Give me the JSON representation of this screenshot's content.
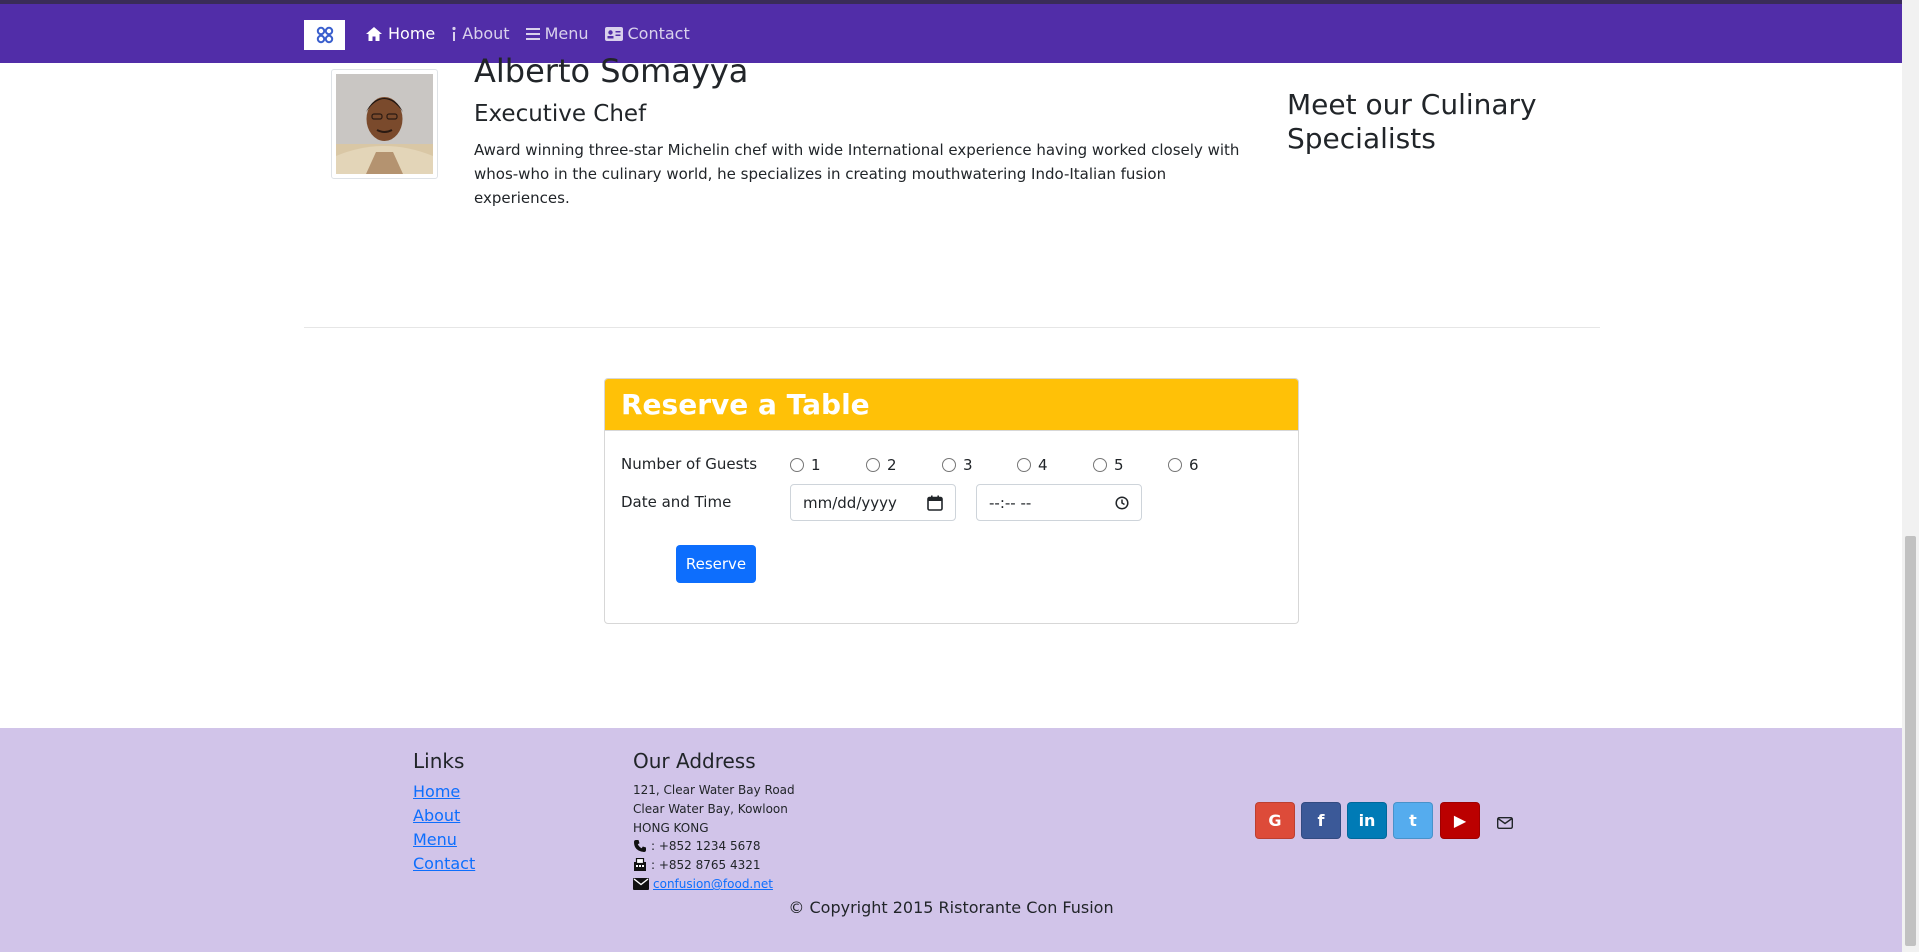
{
  "nav": {
    "items": [
      {
        "label": "Home",
        "icon": "home-icon"
      },
      {
        "label": "About",
        "icon": "info-icon"
      },
      {
        "label": "Menu",
        "icon": "list-icon"
      },
      {
        "label": "Contact",
        "icon": "address-card-icon"
      }
    ]
  },
  "leader": {
    "name": "Alberto Somayya",
    "title": "Executive Chef",
    "description": "Award winning three-star Michelin chef with wide International experience having worked closely with whos-who in the culinary world, he specializes in creating mouthwatering Indo-Italian fusion experiences."
  },
  "side_heading": "Meet our Culinary Specialists",
  "reservation": {
    "title": "Reserve a Table",
    "guests_label": "Number of Guests",
    "guest_options": [
      "1",
      "2",
      "3",
      "4",
      "5",
      "6"
    ],
    "datetime_label": "Date and Time",
    "date_placeholder": "mm/dd/yyyy",
    "time_placeholder": "--:-- --",
    "button_label": "Reserve"
  },
  "footer": {
    "links_heading": "Links",
    "links": [
      "Home",
      "About",
      "Menu",
      "Contact"
    ],
    "address_heading": "Our Address",
    "address_lines": [
      "121, Clear Water Bay Road",
      "Clear Water Bay, Kowloon",
      "HONG KONG"
    ],
    "phone": ": +852 1234 5678",
    "fax": ": +852 8765 4321",
    "email": "confusion@food.net",
    "social": [
      {
        "name": "google",
        "glyph": "G",
        "color": "#dd4b39"
      },
      {
        "name": "facebook",
        "glyph": "f",
        "color": "#3b5998"
      },
      {
        "name": "linkedin",
        "glyph": "in",
        "color": "#007bb6"
      },
      {
        "name": "twitter",
        "glyph": "t",
        "color": "#55acee"
      },
      {
        "name": "youtube",
        "glyph": "▶",
        "color": "#bb0000"
      }
    ],
    "copyright": "© Copyright 2015 Ristorante Con Fusion"
  },
  "colors": {
    "navbar": "#512da8",
    "card_header": "#ffc107",
    "footer_bg": "#d1c4e9",
    "primary": "#0d6efd"
  }
}
